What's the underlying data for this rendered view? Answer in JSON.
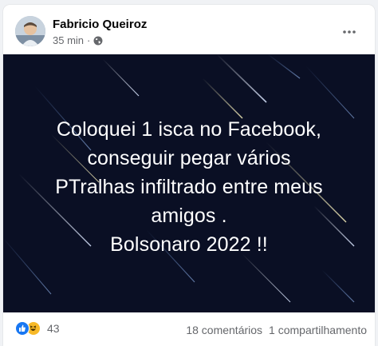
{
  "post": {
    "author": "Fabricio Queiroz",
    "timestamp": "35 min",
    "separator": "·",
    "privacy_icon": "globe-icon",
    "more_icon": "more-dots-icon",
    "image": {
      "background_color": "#0a0f24",
      "caption_lines": [
        "Coloquei 1 isca no Facebook,",
        "conseguir pegar vários",
        "PTralhas infiltrado entre meus",
        "amigos .",
        "Bolsonaro 2022 !!"
      ]
    },
    "footer": {
      "reaction_icons": [
        "like-icon",
        "haha-icon"
      ],
      "reaction_count": "43",
      "comments": "18 comentários",
      "shares": "1 compartilhamento"
    }
  },
  "colors": {
    "brand_blue": "#1877f2",
    "haha_yellow": "#f7b928",
    "secondary_text": "#65676b"
  }
}
